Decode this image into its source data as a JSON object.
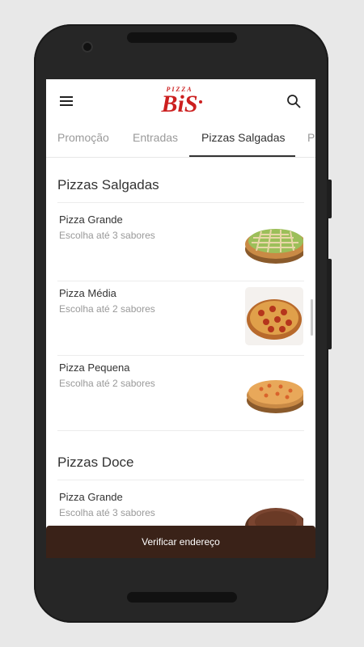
{
  "app": {
    "logo_top_text": "PIZZA",
    "logo_text": "BiS",
    "brand_color": "#cc1f1f"
  },
  "tabs": [
    {
      "label": "Promoção"
    },
    {
      "label": "Entradas"
    },
    {
      "label": "Pizzas Salgadas",
      "active": true
    },
    {
      "label": "P"
    }
  ],
  "sections": [
    {
      "title": "Pizzas Salgadas",
      "items": [
        {
          "title": "Pizza Grande",
          "subtitle": "Escolha até 3 sabores"
        },
        {
          "title": "Pizza Média",
          "subtitle": "Escolha até 2 sabores"
        },
        {
          "title": "Pizza Pequena",
          "subtitle": "Escolha até 2 sabores"
        }
      ]
    },
    {
      "title": "Pizzas Doce",
      "items": [
        {
          "title": "Pizza Grande",
          "subtitle": "Escolha até 3 sabores"
        }
      ]
    }
  ],
  "cta": {
    "label": "Verificar endereço",
    "color": "#3a2218"
  }
}
